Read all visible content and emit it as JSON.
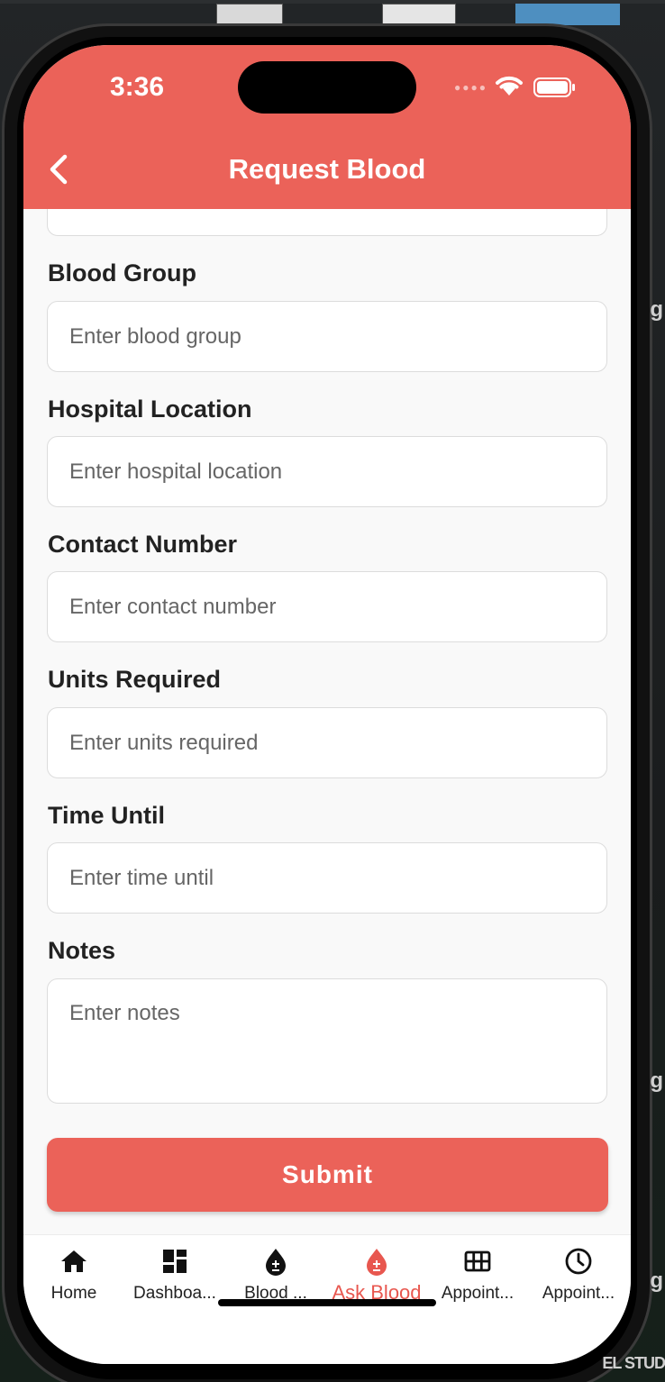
{
  "status_bar": {
    "time": "3:36"
  },
  "header": {
    "title": "Request Blood"
  },
  "form": {
    "fields": [
      {
        "label": "Blood Group",
        "placeholder": "Enter blood group"
      },
      {
        "label": "Hospital Location",
        "placeholder": "Enter hospital location"
      },
      {
        "label": "Contact Number",
        "placeholder": "Enter contact number"
      },
      {
        "label": "Units Required",
        "placeholder": "Enter units required"
      },
      {
        "label": "Time Until",
        "placeholder": "Enter time until"
      },
      {
        "label": "Notes",
        "placeholder": "Enter notes"
      }
    ],
    "submit_label": "Submit"
  },
  "nav": {
    "items": [
      {
        "label": "Home",
        "icon": "home-icon"
      },
      {
        "label": "Dashboa...",
        "icon": "dashboard-icon"
      },
      {
        "label": "Blood ...",
        "icon": "blood-drop-icon"
      },
      {
        "label": "Ask Blood",
        "icon": "blood-drop-icon",
        "active": true
      },
      {
        "label": "Appoint...",
        "icon": "grid-icon"
      },
      {
        "label": "Appoint...",
        "icon": "clock-icon"
      }
    ]
  },
  "colors": {
    "accent": "#eb6259",
    "active_nav": "#e8574f",
    "background": "#f9f9f9"
  }
}
